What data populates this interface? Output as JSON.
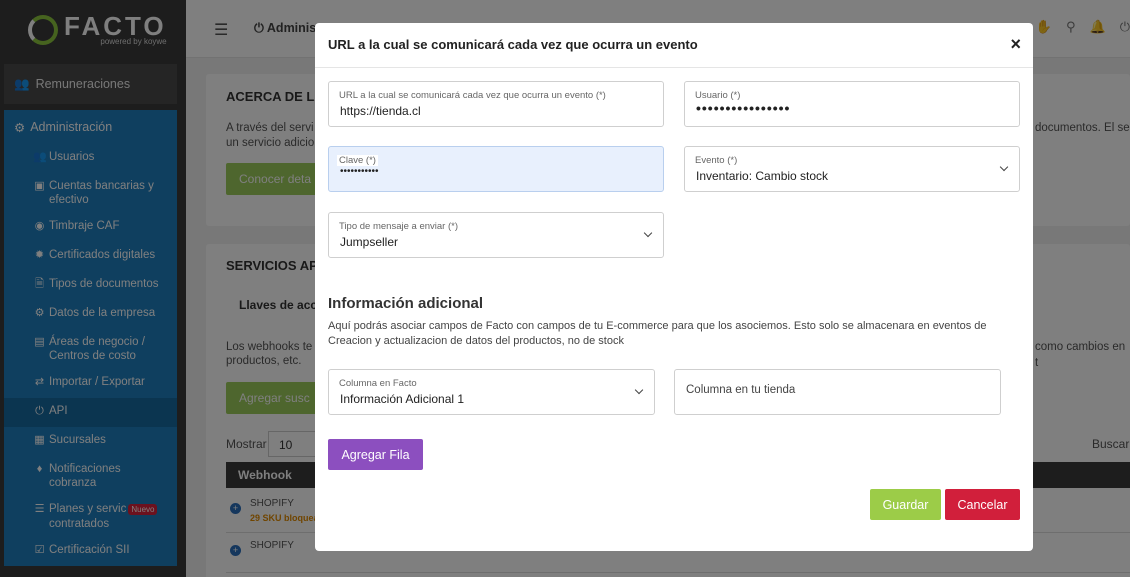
{
  "brand": {
    "name": "FACTO",
    "tagline": "powered by koywe"
  },
  "sidebar": {
    "top_item": "Remuneraciones",
    "group_label": "Administración",
    "items": [
      {
        "label": "Usuarios",
        "icon": "users-icon"
      },
      {
        "label": "Cuentas bancarias y efectivo",
        "icon": "bank-icon"
      },
      {
        "label": "Timbraje CAF",
        "icon": "stamp-icon"
      },
      {
        "label": "Certificados digitales",
        "icon": "certificate-icon"
      },
      {
        "label": "Tipos de documentos",
        "icon": "document-icon"
      },
      {
        "label": "Datos de la empresa",
        "icon": "gear-icon"
      },
      {
        "label": "Áreas de negocio / Centros de costo",
        "icon": "folder-icon"
      },
      {
        "label": "Importar / Exportar",
        "icon": "exchange-icon"
      },
      {
        "label": "API",
        "icon": "plug-icon"
      },
      {
        "label": "Sucursales",
        "icon": "building-icon"
      },
      {
        "label": "Notificaciones cobranza",
        "icon": "bell-icon"
      },
      {
        "label": "Planes y servic",
        "label2": "contratados",
        "badge": "Nuevo",
        "icon": "list-icon"
      },
      {
        "label": "Certificación SII",
        "icon": "check-icon"
      }
    ]
  },
  "topbar": {
    "section": "Administ"
  },
  "background": {
    "card1_title": "ACERCA DE LA",
    "card1_text_a": "A través del servi",
    "card1_text_b": "un servicio adicio",
    "card1_text_right": "documentos. El se",
    "card1_button": "Conocer deta",
    "card2_title": "SERVICIOS API",
    "card2_tab": "Llaves de acce",
    "card2_text_a": "Los webhooks te",
    "card2_text_b": "productos, etc.",
    "card2_text_right": "como cambios en t",
    "card2_button": "Agregar susc",
    "show_label": "Mostrar",
    "show_value": "10",
    "search_label": "Buscar:",
    "table_header": "Webhook",
    "rows": [
      {
        "name": "SHOPIFY",
        "sub": "29 SKU bloquea"
      },
      {
        "name": "SHOPIFY",
        "sub": ""
      }
    ]
  },
  "modal": {
    "title": "URL a la cual se comunicará cada vez que ocurra un evento",
    "close": "×",
    "fields": {
      "url": {
        "label": "URL a la cual se comunicará cada vez que ocurra un evento (*)",
        "value": "https://tienda.cl"
      },
      "user": {
        "label": "Usuario (*)",
        "value": "••••••••••••••••"
      },
      "key": {
        "label": "Clave (*)",
        "value": "•••••••••••"
      },
      "event": {
        "label": "Evento (*)",
        "value": "Inventario: Cambio stock"
      },
      "msg_type": {
        "label": "Tipo de mensaje a enviar (*)",
        "value": "Jumpseller"
      }
    },
    "info_title": "Información adicional",
    "info_text": "Aquí podrás asociar campos de Facto con campos de tu E-commerce para que los asociemos. Esto solo se almacenara en eventos de Creacion y actualizacion de datos del productos, no de stock",
    "facto_column": {
      "label": "Columna en Facto",
      "value": "Información Adicional 1"
    },
    "store_column_placeholder": "Columna en tu tienda",
    "add_row": "Agregar Fila",
    "save": "Guardar",
    "cancel": "Cancelar"
  }
}
